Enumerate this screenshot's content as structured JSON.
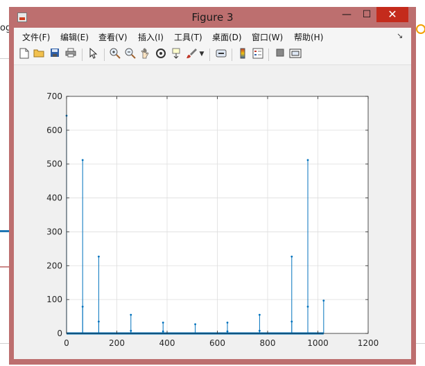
{
  "background": {
    "partial_text": "og"
  },
  "window": {
    "title": "Figure 3",
    "minimize_symbol": "—",
    "maximize_symbol": "☐",
    "close_symbol": "✕"
  },
  "menu": {
    "items": [
      "文件(F)",
      "编辑(E)",
      "查看(V)",
      "插入(I)",
      "工具(T)",
      "桌面(D)",
      "窗口(W)",
      "帮助(H)"
    ],
    "overflow_symbol": "↘"
  },
  "toolbar": {
    "icons": [
      "new-file-icon",
      "open-folder-icon",
      "save-icon",
      "print-icon",
      "select-arrow-icon",
      "zoom-in-icon",
      "zoom-out-icon",
      "pan-hand-icon",
      "rotate-3d-icon",
      "data-cursor-icon",
      "brush-icon",
      "link-plot-icon",
      "colorbar-icon",
      "legend-icon",
      "hide-plot-tools-icon",
      "show-plot-tools-icon"
    ]
  },
  "chart_data": {
    "type": "stem",
    "title": "",
    "xlabel": "",
    "ylabel": "",
    "xlim": [
      0,
      1200
    ],
    "ylim": [
      0,
      700
    ],
    "x_ticks": [
      0,
      200,
      400,
      600,
      800,
      1000,
      1200
    ],
    "y_ticks": [
      0,
      100,
      200,
      300,
      400,
      500,
      600,
      700
    ],
    "grid": true,
    "color": "#0072bd",
    "series": [
      {
        "points": [
          {
            "x": 0,
            "y": 643
          },
          {
            "x": 64,
            "y": 512
          },
          {
            "x": 64,
            "y": 79
          },
          {
            "x": 128,
            "y": 227
          },
          {
            "x": 128,
            "y": 35
          },
          {
            "x": 256,
            "y": 55
          },
          {
            "x": 256,
            "y": 8
          },
          {
            "x": 384,
            "y": 32
          },
          {
            "x": 384,
            "y": 6
          },
          {
            "x": 512,
            "y": 27
          },
          {
            "x": 640,
            "y": 32
          },
          {
            "x": 640,
            "y": 6
          },
          {
            "x": 768,
            "y": 55
          },
          {
            "x": 768,
            "y": 8
          },
          {
            "x": 896,
            "y": 227
          },
          {
            "x": 896,
            "y": 35
          },
          {
            "x": 960,
            "y": 512
          },
          {
            "x": 960,
            "y": 79
          },
          {
            "x": 1023,
            "y": 97
          }
        ],
        "baseline_x_range": [
          0,
          1023
        ]
      }
    ]
  }
}
